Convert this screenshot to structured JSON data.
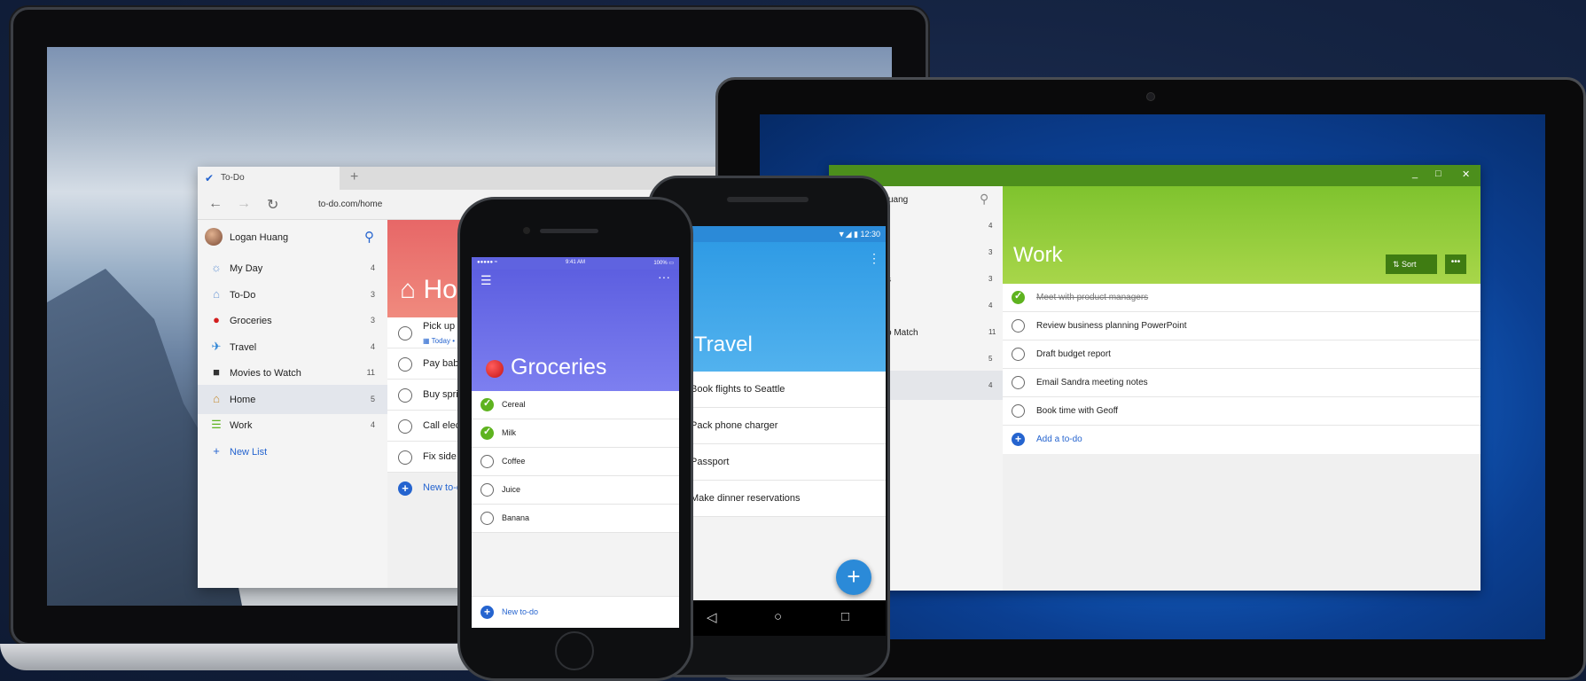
{
  "laptop": {
    "tab_label": "To-Do",
    "tab_new": "+",
    "url": "to-do.com/home",
    "user_name": "Logan Huang",
    "sidebar": [
      {
        "label": "My Day",
        "count": "4",
        "icon": "sun-icon",
        "glyph": "☼",
        "color": "#6f9bd6"
      },
      {
        "label": "To-Do",
        "count": "3",
        "icon": "home-outline-icon",
        "glyph": "⌂",
        "color": "#6f9bd6"
      },
      {
        "label": "Groceries",
        "count": "3",
        "icon": "apple-icon",
        "glyph": "●",
        "color": "#d31d1d"
      },
      {
        "label": "Travel",
        "count": "4",
        "icon": "plane-icon",
        "glyph": "✈",
        "color": "#2a82d5"
      },
      {
        "label": "Movies to Watch",
        "count": "11",
        "icon": "film-camera-icon",
        "glyph": "■",
        "color": "#333333"
      },
      {
        "label": "Home",
        "count": "5",
        "icon": "house-icon",
        "glyph": "⌂",
        "color": "#c68b2f"
      },
      {
        "label": "Work",
        "count": "4",
        "icon": "list-icon",
        "glyph": "☰",
        "color": "#5eb31f"
      }
    ],
    "new_list": "New List",
    "list_title": "Home",
    "tasks": [
      {
        "text": "Pick up Dave fror",
        "sub": "▦ Today  •  ▦ Tod"
      },
      {
        "text": "Pay babysitter fo"
      },
      {
        "text": "Buy spring flowe"
      },
      {
        "text": "Call electrician to"
      },
      {
        "text": "Fix side gate"
      }
    ],
    "add_label": "New to-do"
  },
  "iphone": {
    "status_left": "●●●●● ≈",
    "status_time": "9:41 AM",
    "status_right": "100% ▭",
    "list_title": "Groceries",
    "items": [
      {
        "text": "Cereal",
        "done": true
      },
      {
        "text": "Milk",
        "done": true
      },
      {
        "text": "Coffee",
        "done": false
      },
      {
        "text": "Juice",
        "done": false
      },
      {
        "text": "Banana",
        "done": false
      }
    ],
    "add_label": "New to-do"
  },
  "android": {
    "status": "▼◢ ▮ 12:30",
    "list_title": "Travel",
    "items": [
      {
        "text": "Book flights to Seattle"
      },
      {
        "text": "Pack phone charger"
      },
      {
        "text": "Passport"
      },
      {
        "text": "Make dinner reservations"
      }
    ],
    "fab": "+",
    "nav": [
      "◁",
      "○",
      "□"
    ]
  },
  "tablet": {
    "user_partial": "uang",
    "sidebar": [
      {
        "label": "",
        "count": "4"
      },
      {
        "label": "",
        "count": "3"
      },
      {
        "label": "s",
        "count": "3"
      },
      {
        "label": "",
        "count": "4"
      },
      {
        "label": "o Match",
        "count": "11"
      },
      {
        "label": "",
        "count": "5"
      },
      {
        "label": "",
        "count": "4"
      }
    ],
    "list_title": "Work",
    "sort_label": "Sort",
    "more_label": "•••",
    "tasks": [
      {
        "text": "Meet with product managers",
        "done": true
      },
      {
        "text": "Review business planning PowerPoint",
        "done": false
      },
      {
        "text": "Draft budget report",
        "done": false
      },
      {
        "text": "Email Sandra meeting notes",
        "done": false
      },
      {
        "text": "Book time with Geoff",
        "done": false
      }
    ],
    "add_label": "Add a to-do",
    "window_controls": [
      "_",
      "□",
      "✕"
    ]
  },
  "colors": {
    "accent_blue": "#2564cf",
    "home_header": "#e76767",
    "work_header": "#7fc32e",
    "groceries_header": "#5d5fe0",
    "travel_header": "#2f9be5",
    "done_green": "#5eb31f"
  }
}
